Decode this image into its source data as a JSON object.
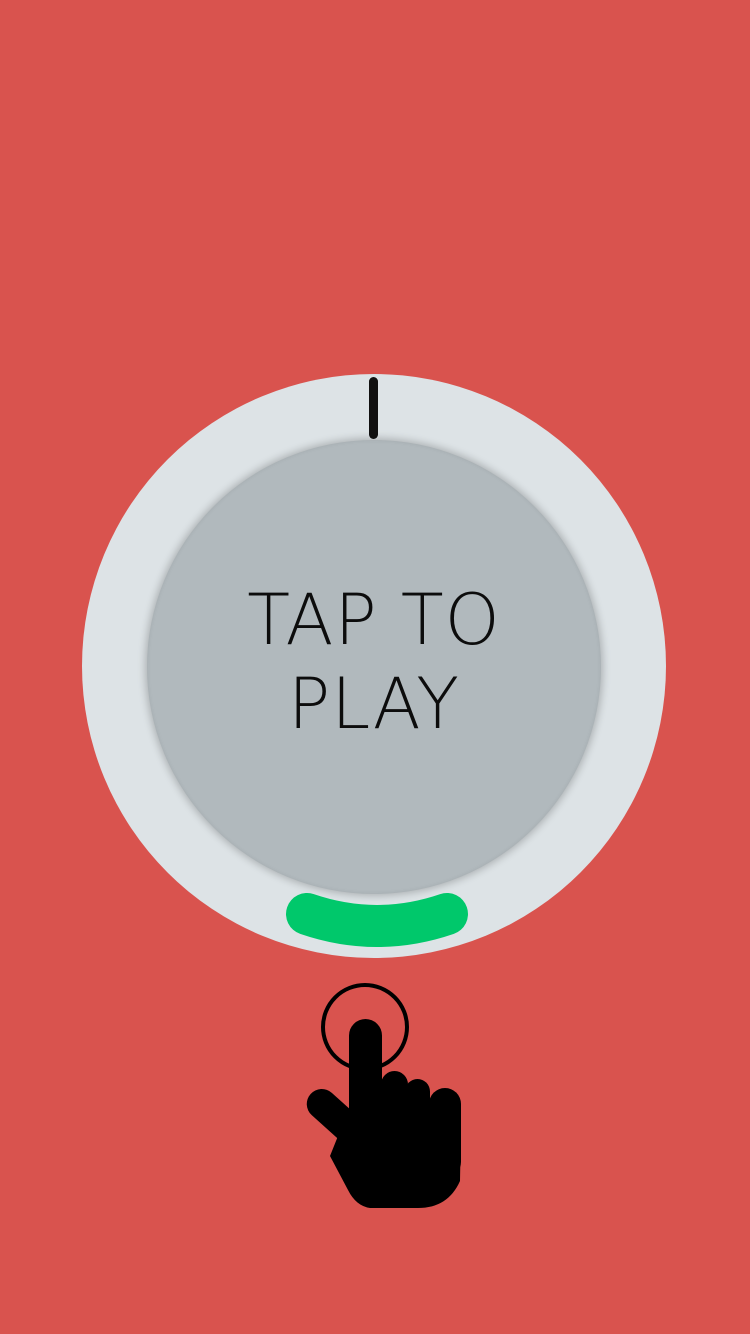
{
  "game": {
    "background_color": "#d9534e",
    "dial_color": "#dde3e6",
    "button_color": "#b1b9bd",
    "target_zone_color": "#00c86b",
    "needle_color": "#111111",
    "play_label_line1": "TAP TO",
    "play_label_line2": "PLAY",
    "tap_hint_icon": "tap-hand-icon"
  }
}
